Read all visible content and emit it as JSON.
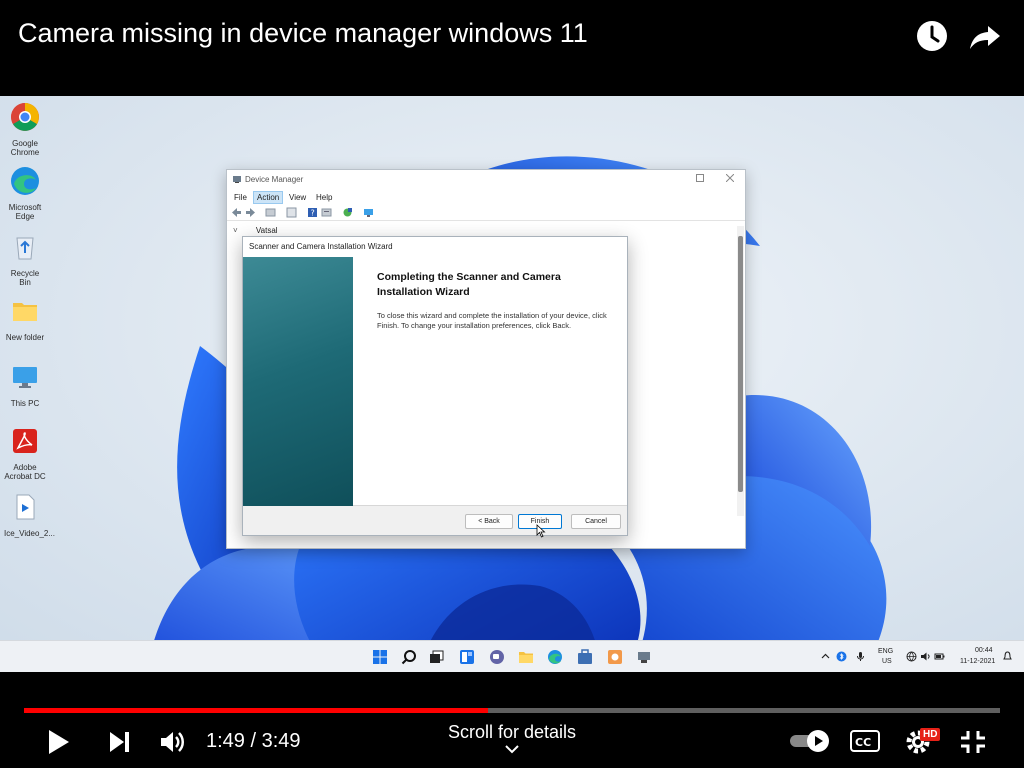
{
  "video": {
    "title": "Camera missing in device manager windows 11",
    "current_time": "1:49",
    "duration": "3:49",
    "time_display": "1:49 / 3:49",
    "progress_fraction": 0.4759,
    "scroll_hint": "Scroll for details",
    "hd_badge": "HD"
  },
  "desktop": {
    "icons": [
      {
        "label": "Google Chrome",
        "icon": "chrome-icon"
      },
      {
        "label": "Microsoft Edge",
        "icon": "edge-icon"
      },
      {
        "label": "Recycle Bin",
        "icon": "recycle-bin-icon"
      },
      {
        "label": "New folder",
        "icon": "folder-icon"
      },
      {
        "label": "This PC",
        "icon": "monitor-icon"
      },
      {
        "label": "Adobe Acrobat DC",
        "icon": "acrobat-icon"
      },
      {
        "label": "Ice_Video_2...",
        "icon": "video-file-icon"
      }
    ]
  },
  "device_manager": {
    "title": "Device Manager",
    "menu": [
      "File",
      "Action",
      "View",
      "Help"
    ],
    "active_menu": "Action",
    "tree_root": "Vatsal"
  },
  "wizard": {
    "title": "Scanner and Camera Installation Wizard",
    "heading": "Completing the Scanner and Camera Installation Wizard",
    "body": "To close this wizard and complete the installation of your device, click Finish. To change your installation preferences, click Back.",
    "back_label": "< Back",
    "finish_label": "Finish",
    "cancel_label": "Cancel"
  },
  "taskbar": {
    "apps": [
      "start-icon",
      "search-icon",
      "task-view-icon",
      "widgets-icon",
      "chat-icon",
      "file-explorer-icon",
      "edge-icon",
      "store-icon",
      "paint-icon",
      "device-manager-icon"
    ],
    "language_line1": "ENG",
    "language_line2": "US",
    "clock_time": "00:44",
    "clock_date": "11-12-2021"
  },
  "colors": {
    "progress": "#ff0000",
    "accent": "#0078d4",
    "wizard_side": "#1e6a76"
  }
}
